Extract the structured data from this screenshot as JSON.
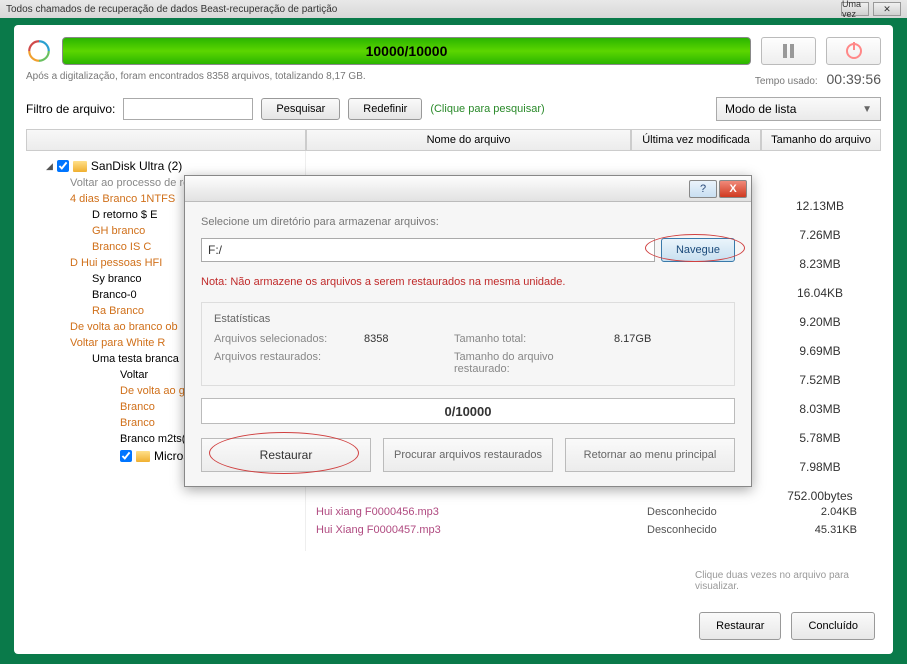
{
  "window": {
    "title": "Todos chamados de recuperação de dados Beast-recuperação de partição",
    "minimize_label": "Uma vez",
    "close_symbol": "✕"
  },
  "progress": {
    "text": "10000/10000"
  },
  "scan_info": "Após a digitalização, foram encontrados 8358 arquivos, totalizando 8,17 GB.",
  "time_label": "Tempo usado:",
  "time_value": "00:39:56",
  "filter": {
    "label": "Filtro de arquivo:",
    "search": "Pesquisar",
    "reset": "Redefinir",
    "hint": "(Clique para pesquisar)"
  },
  "mode": "Modo de lista",
  "headers": {
    "name": "Nome do arquivo",
    "date": "Última vez modificada",
    "size": "Tamanho do arquivo"
  },
  "tree": {
    "root": "SanDisk Ultra (2)",
    "items": [
      "Voltar ao processo de recuperação 0FAT 1",
      "4 dias Branco 1NTFS",
      "D retorno $ E",
      "GH branco",
      "Branco IS C",
      "D Hui pessoas HFI",
      "Sy branco",
      "Branco-0",
      "Ra Branco",
      "De volta ao branco ob",
      "Voltar para White R",
      "Uma testa branca",
      "Voltar",
      "De volta ao gráfico",
      "Branco",
      "Branco",
      "Branco m2ts(1)",
      "Microsoft Office Files"
    ]
  },
  "list_rows": [
    {
      "name": "Hui xiang F0000456.mp3",
      "date": "Desconhecido",
      "size": "2.04KB"
    },
    {
      "name": "Hui Xiang F0000457.mp3",
      "date": "Desconhecido",
      "size": "45.31KB"
    }
  ],
  "sizes": [
    "12.13MB",
    "7.26MB",
    "8.23MB",
    "16.04KB",
    "9.20MB",
    "9.69MB",
    "7.52MB",
    "8.03MB",
    "5.78MB",
    "7.98MB",
    "752.00bytes"
  ],
  "bottom_hint": "Clique duas vezes no arquivo para visualizar.",
  "footer": {
    "restore": "Restaurar",
    "done": "Concluído"
  },
  "dialog": {
    "prompt": "Selecione um diretório para armazenar arquivos:",
    "path": "F:/",
    "browse": "Navegue",
    "note": "Nota: Não armazene os arquivos a serem restaurados na mesma unidade.",
    "stats_title": "Estatísticas",
    "files_selected_label": "Arquivos selecionados:",
    "files_selected": "8358",
    "total_size_label": "Tamanho total:",
    "total_size": "8.17GB",
    "files_restored_label": "Arquivos restaurados:",
    "restored_size_label": "Tamanho do arquivo restaurado:",
    "inner_progress": "0/10000",
    "btn_restore": "Restaurar",
    "btn_search": "Procurar arquivos restaurados",
    "btn_return": "Retornar ao menu principal"
  }
}
